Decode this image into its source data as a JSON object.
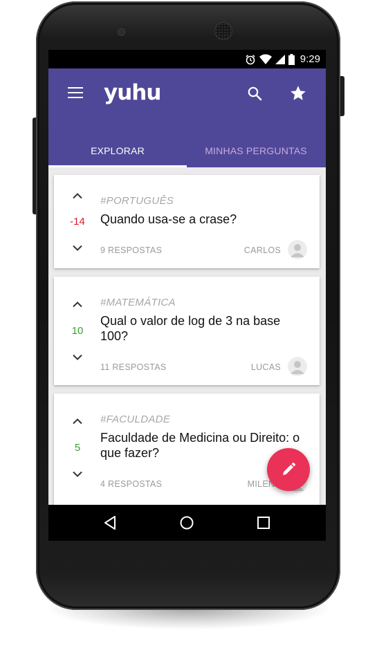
{
  "colors": {
    "primary": "#4f4898",
    "tab_inactive": "#c9a9df",
    "negative_score": "#e21b2a",
    "positive_score": "#35a12e",
    "fab": "#ea3157",
    "tag_gray": "#a7a7a7"
  },
  "status_bar": {
    "time": "9:29",
    "icons": [
      "alarm-icon",
      "wifi-icon",
      "signal-icon",
      "battery-icon"
    ]
  },
  "app_bar": {
    "logo": "yuhu",
    "menu_icon": "menu-icon",
    "search_icon": "search-icon",
    "star_icon": "star-icon"
  },
  "tabs": [
    {
      "label": "EXPLORAR",
      "active": true
    },
    {
      "label": "MINHAS PERGUNTAS",
      "active": false
    }
  ],
  "questions": [
    {
      "score": "-14",
      "tag": "#PORTUGUÊS",
      "title": "Quando usa-se a crase?",
      "answers": "9 RESPOSTAS",
      "author": "CARLOS"
    },
    {
      "score": "10",
      "tag": "#MATEMÁTICA",
      "title": "Qual o valor de log de 3 na base 100?",
      "answers": "11 RESPOSTAS",
      "author": "LUCAS"
    },
    {
      "score": "5",
      "tag": "#FACULDADE",
      "title": "Faculdade de Medicina ou Direito: o que fazer?",
      "answers": "4 RESPOSTAS",
      "author": "MILENA"
    }
  ],
  "fab": {
    "icon": "pencil-icon"
  },
  "nav_bar": {
    "icons": [
      "back-icon",
      "home-icon",
      "recents-icon"
    ]
  }
}
